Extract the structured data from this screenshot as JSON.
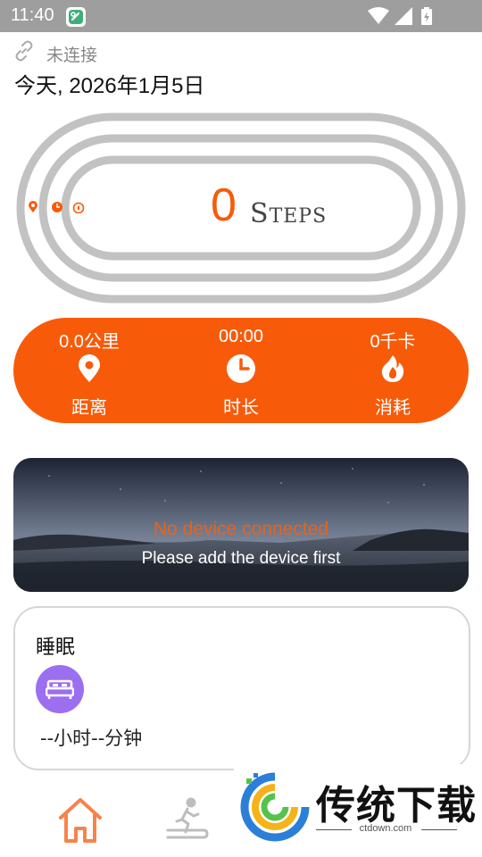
{
  "status_bar": {
    "time": "11:40"
  },
  "connection": {
    "text": "未连接"
  },
  "date_label": "今天, 2026年1月5日",
  "steps": {
    "value": "0",
    "unit_big": "S",
    "unit_small": "TEPS"
  },
  "stats": [
    {
      "value": "0.0公里",
      "label": "距离",
      "icon": "location-pin-icon"
    },
    {
      "value": "00:00",
      "label": "时长",
      "icon": "clock-icon"
    },
    {
      "value": "0千卡",
      "label": "消耗",
      "icon": "flame-icon"
    }
  ],
  "device_banner": {
    "title": "No device connected",
    "subtitle": "Please add the device first"
  },
  "sleep_card": {
    "title": "睡眠",
    "duration": "--小时--分钟",
    "icon": "bed-icon"
  },
  "tabs": [
    {
      "name": "home",
      "icon": "home-icon",
      "active": true
    },
    {
      "name": "sport",
      "icon": "treadmill-runner-icon",
      "active": false
    }
  ],
  "watermark": {
    "name": "传统下载",
    "url": "ctdown.com"
  },
  "colors": {
    "accent": "#f75b0a",
    "status_bar": "#9e9e9e",
    "track": "#c2c2c2",
    "sleep_badge": "#9c6ef0"
  }
}
